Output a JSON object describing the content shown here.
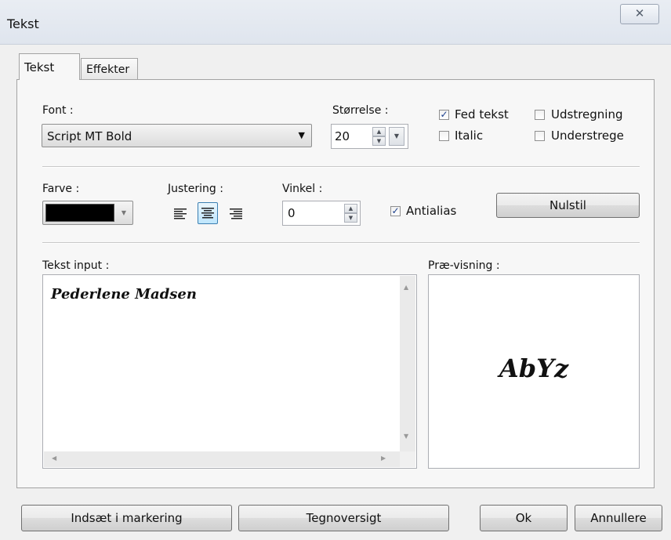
{
  "window": {
    "title": "Tekst",
    "close_glyph": "✕"
  },
  "tabs": [
    {
      "label": "Tekst",
      "active": true
    },
    {
      "label": "Effekter",
      "active": false
    }
  ],
  "font": {
    "label": "Font :",
    "value": "Script MT Bold",
    "arrow": "▼"
  },
  "size": {
    "label": "Størrelse :",
    "value": "20"
  },
  "style_options": {
    "bold": {
      "label": "Fed tekst",
      "checked": true
    },
    "italic": {
      "label": "Italic",
      "checked": false
    },
    "strike": {
      "label": "Udstregning",
      "checked": false
    },
    "underline": {
      "label": "Understrege",
      "checked": false
    }
  },
  "color": {
    "label": "Farve :",
    "value": "#000000"
  },
  "alignment": {
    "label": "Justering :",
    "options": [
      "left",
      "center",
      "right"
    ],
    "selected": "center"
  },
  "angle": {
    "label": "Vinkel :",
    "value": "0"
  },
  "antialias": {
    "label": "Antialias",
    "checked": true
  },
  "reset_button": "Nulstil",
  "text_input": {
    "label": "Tekst input :",
    "value": "Pederlene Madsen"
  },
  "preview": {
    "label": "Præ-visning :",
    "sample": "AbYz"
  },
  "buttons": {
    "insert": "Indsæt i markering",
    "charmap": "Tegnoversigt",
    "ok": "Ok",
    "cancel": "Annullere"
  },
  "icons": {
    "spin_up": "▲",
    "spin_down": "▼",
    "check": "✓",
    "scroll_up": "▲",
    "scroll_down": "▼",
    "scroll_left": "◀",
    "scroll_right": "▶"
  }
}
